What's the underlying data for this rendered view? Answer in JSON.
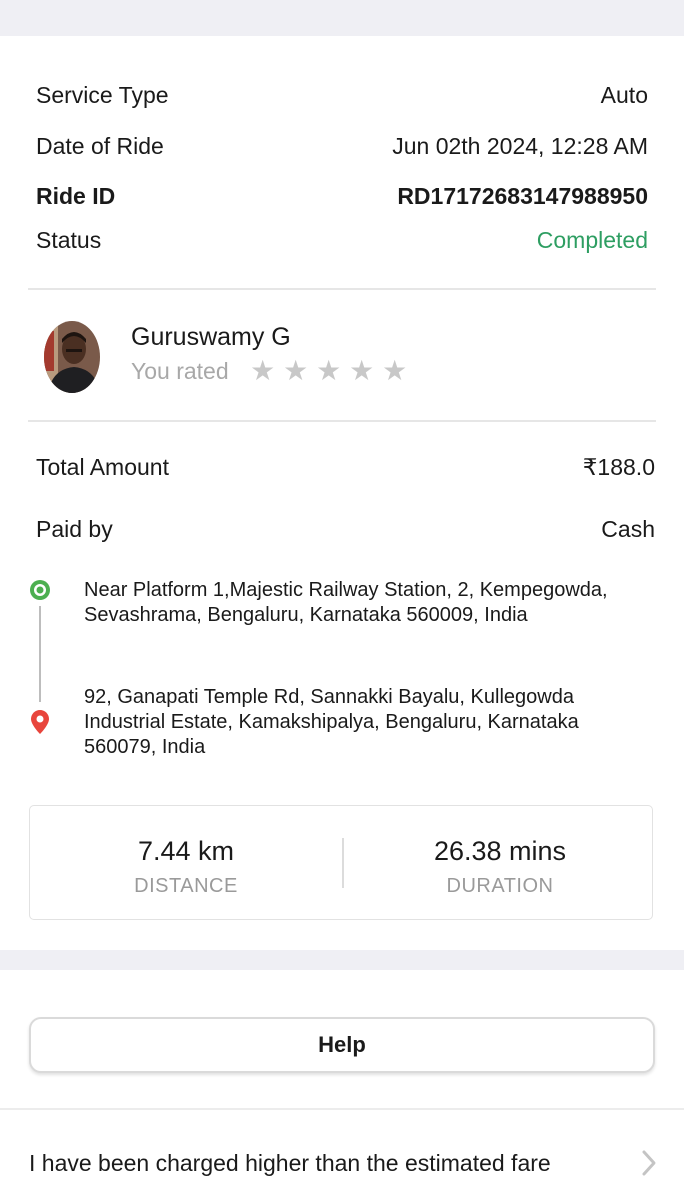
{
  "ride_details": {
    "service_type": {
      "label": "Service Type",
      "value": "Auto"
    },
    "date_of_ride": {
      "label": "Date of Ride",
      "value": "Jun 02th 2024, 12:28 AM"
    },
    "ride_id": {
      "label": "Ride ID",
      "value": "RD17172683147988950"
    },
    "status": {
      "label": "Status",
      "value": "Completed",
      "color": "#2e9e62"
    }
  },
  "driver": {
    "name": "Guruswamy G",
    "rated_label": "You rated",
    "rating": 0,
    "max_rating": 5
  },
  "payment": {
    "total_label": "Total Amount",
    "total_value": "₹188.0",
    "paid_by_label": "Paid by",
    "paid_by_value": "Cash"
  },
  "route": {
    "pickup_address": "Near Platform 1,Majestic Railway Station, 2, Kempegowda, Sevashrama, Bengaluru, Karnataka 560009, India",
    "drop_address": "92, Ganapati Temple Rd, Sannakki Bayalu, Kullegowda Industrial Estate, Kamakshipalya, Bengaluru, Karnataka 560079, India",
    "pickup_icon": "pickup-dot-icon",
    "drop_icon": "location-pin-icon",
    "pickup_color": "#4caf50",
    "drop_color": "#e8453c"
  },
  "stats": {
    "distance_value": "7.44 km",
    "distance_label": "DISTANCE",
    "duration_value": "26.38 mins",
    "duration_label": "DURATION"
  },
  "help": {
    "button_label": "Help",
    "issue_item": "I have been charged higher than the estimated fare",
    "issue_icon": "chevron-right-icon"
  }
}
